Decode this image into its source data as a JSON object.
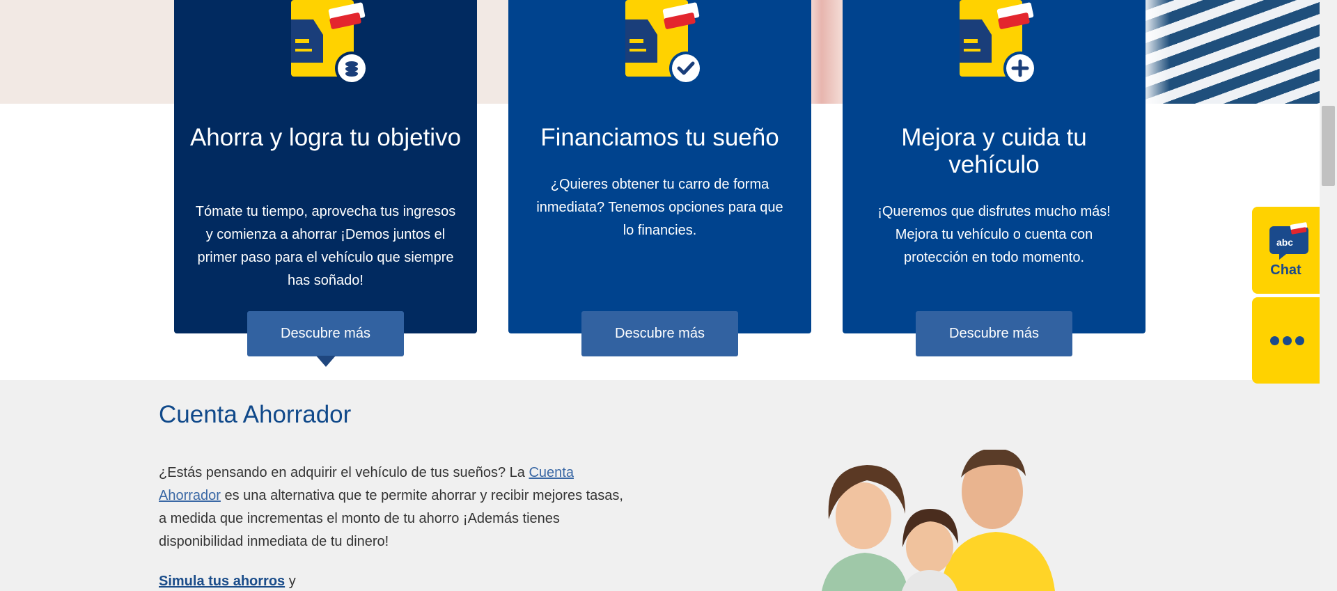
{
  "cards": [
    {
      "title": "Ahorra y logra tu objetivo",
      "text": "Tómate tu tiempo, aprovecha tus ingresos y comienza a ahorrar ¡Demos juntos el primer paso para el vehículo que siempre has soñado!",
      "button": "Descubre más",
      "icon": "car-savings-coins-icon",
      "background": "#012a60"
    },
    {
      "title": "Financiamos tu sueño",
      "text": "¿Quieres obtener tu carro de forma inmediata? Tenemos opciones para que lo financies.",
      "button": "Descubre más",
      "icon": "car-financing-check-icon",
      "background": "#00438e"
    },
    {
      "title": "Mejora y cuida tu vehículo",
      "text": "¡Queremos que disfrutes mucho más! Mejora tu vehículo o cuenta con protección en todo momento.",
      "button": "Descubre más",
      "icon": "car-protection-plus-icon",
      "background": "#00438e"
    }
  ],
  "section": {
    "title": "Cuenta Ahorrador",
    "intro_before": "¿Estás pensando en adquirir el vehículo de tus sueños?  La ",
    "link": "Cuenta Ahorrador",
    "intro_after": " es una alternativa que te permite ahorrar y recibir mejores tasas, a medida que incrementas el monto de tu ahorro ¡Además tienes disponibilidad inmediata de tu dinero!",
    "cta_link": "Simula tus ahorros",
    "cta_after": " y"
  },
  "widgets": {
    "chat_label": "Chat",
    "chat_logo_text": "abc",
    "more_icon": "more-dots-icon"
  },
  "colors": {
    "card_dark": "#012a60",
    "card_blue": "#00438e",
    "button": "#3262a1",
    "accent_yellow": "#ffd200",
    "title_blue": "#10498a"
  }
}
